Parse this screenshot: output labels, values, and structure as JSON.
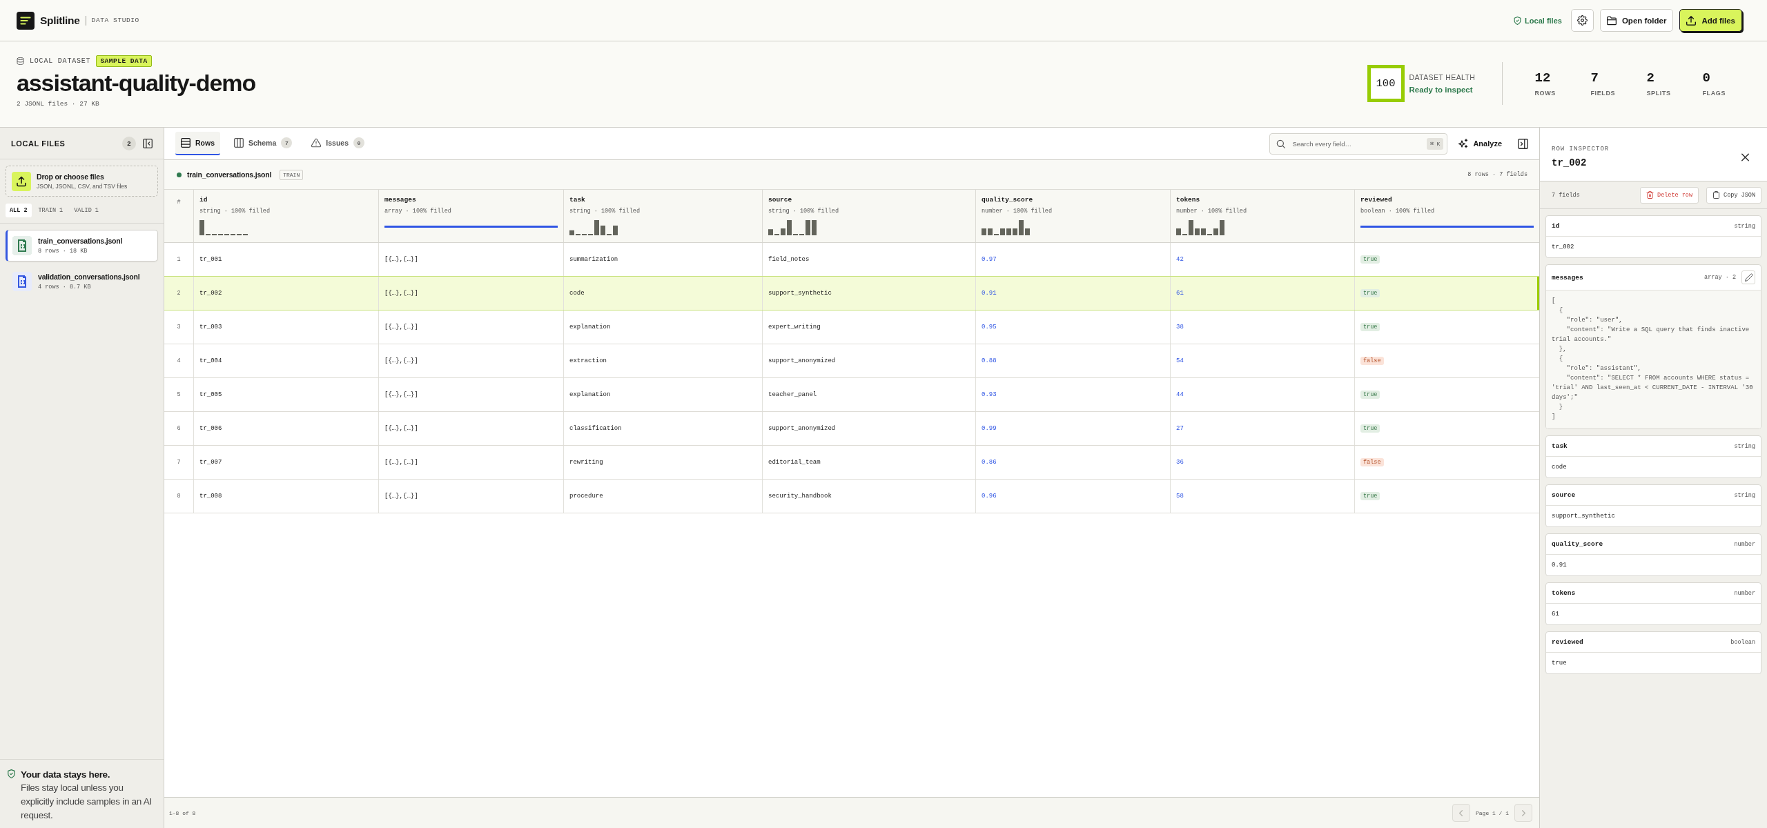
{
  "app": {
    "name": "Splitline",
    "product": "DATA STUDIO"
  },
  "topbar": {
    "status": "Local files",
    "buttons": [
      {
        "kind": "settings"
      },
      {
        "kind": "open",
        "label": "Open folder"
      },
      {
        "kind": "add",
        "label": "Add files"
      }
    ]
  },
  "dataset": {
    "eyebrow": "LOCAL DATASET",
    "badge": "SAMPLE DATA",
    "title": "assistant-quality-demo",
    "meta": "2 JSONL files · 27 KB"
  },
  "health": {
    "score": "100",
    "label": "DATASET HEALTH",
    "status": "Ready to inspect"
  },
  "stats": [
    {
      "value": "12",
      "label": "ROWS"
    },
    {
      "value": "7",
      "label": "FIELDS"
    },
    {
      "value": "2",
      "label": "SPLITS"
    },
    {
      "value": "0",
      "label": "FLAGS"
    }
  ],
  "sidebar": {
    "title": "LOCAL FILES",
    "count": "2",
    "dropzone": {
      "title": "Drop or choose files",
      "hint": "JSON, JSONL, CSV, and TSV files"
    },
    "filters": [
      {
        "label": "ALL 2",
        "selected": true
      },
      {
        "label": "TRAIN 1",
        "selected": false
      },
      {
        "label": "VALID 1",
        "selected": false
      }
    ],
    "files": [
      {
        "name": "train_conversations.jsonl",
        "meta": "8 rows · 18 KB",
        "color": "#2f7a4f",
        "selected": true
      },
      {
        "name": "validation_conversations.jsonl",
        "meta": "4 rows · 8.7 KB",
        "color": "#3457e0",
        "selected": false
      }
    ],
    "notice": {
      "title": "Your data stays here.",
      "text": "Files stay local unless you explicitly include samples in an AI request."
    }
  },
  "tabs": [
    {
      "kind": "rows",
      "label": "Rows",
      "selected": true
    },
    {
      "kind": "schema",
      "label": "Schema",
      "count": "7",
      "selected": false
    },
    {
      "kind": "issues",
      "label": "Issues",
      "count": "0",
      "selected": false
    }
  ],
  "search": {
    "placeholder": "Search every field…",
    "shortcut": "⌘ K"
  },
  "analyze_button": {
    "label": "Analyze"
  },
  "file_bar": {
    "name": "train_conversations.jsonl",
    "split": "TRAIN",
    "summary": "8 rows · 7 fields"
  },
  "table": {
    "index_header": "#",
    "columns": [
      {
        "name": "id",
        "type": "string · 100% filled",
        "kind": "string"
      },
      {
        "name": "messages",
        "type": "array · 100% filled",
        "kind": "array"
      },
      {
        "name": "task",
        "type": "string · 100% filled",
        "kind": "string"
      },
      {
        "name": "source",
        "type": "string · 100% filled",
        "kind": "string"
      },
      {
        "name": "quality_score",
        "type": "number · 100% filled",
        "kind": "number"
      },
      {
        "name": "tokens",
        "type": "number · 100% filled",
        "kind": "number"
      },
      {
        "name": "reviewed",
        "type": "boolean · 100% filled",
        "kind": "boolean"
      }
    ],
    "rows": [
      {
        "index": "1",
        "selected": false,
        "cells": [
          "tr_001",
          "[{…},{…}]",
          "summarization",
          "field_notes",
          "0.97",
          "42",
          {
            "text": "true",
            "on": true
          }
        ]
      },
      {
        "index": "2",
        "selected": true,
        "cells": [
          "tr_002",
          "[{…},{…}]",
          "code",
          "support_synthetic",
          "0.91",
          "61",
          {
            "text": "true",
            "on": true
          }
        ]
      },
      {
        "index": "3",
        "selected": false,
        "cells": [
          "tr_003",
          "[{…},{…}]",
          "explanation",
          "expert_writing",
          "0.95",
          "38",
          {
            "text": "true",
            "on": true
          }
        ]
      },
      {
        "index": "4",
        "selected": false,
        "cells": [
          "tr_004",
          "[{…},{…}]",
          "extraction",
          "support_anonymized",
          "0.88",
          "54",
          {
            "text": "false",
            "on": false
          }
        ]
      },
      {
        "index": "5",
        "selected": false,
        "cells": [
          "tr_005",
          "[{…},{…}]",
          "explanation",
          "teacher_panel",
          "0.93",
          "44",
          {
            "text": "true",
            "on": true
          }
        ]
      },
      {
        "index": "6",
        "selected": false,
        "cells": [
          "tr_006",
          "[{…},{…}]",
          "classification",
          "support_anonymized",
          "0.99",
          "27",
          {
            "text": "true",
            "on": true
          }
        ]
      },
      {
        "index": "7",
        "selected": false,
        "cells": [
          "tr_007",
          "[{…},{…}]",
          "rewriting",
          "editorial_team",
          "0.86",
          "36",
          {
            "text": "false",
            "on": false
          }
        ]
      },
      {
        "index": "8",
        "selected": false,
        "cells": [
          "tr_008",
          "[{…},{…}]",
          "procedure",
          "security_handbook",
          "0.96",
          "58",
          {
            "text": "true",
            "on": true
          }
        ]
      }
    ]
  },
  "pagination": {
    "range": "1–8 of 8",
    "page": "Page 1 / 1",
    "prev_disabled": true,
    "next_disabled": true
  },
  "inspector": {
    "eyebrow": "ROW INSPECTOR",
    "title": "tr_002",
    "field_count": "7 fields",
    "actions": [
      {
        "kind": "delete",
        "label": "Delete row"
      },
      {
        "kind": "copy",
        "label": "Copy JSON"
      }
    ],
    "fields": [
      {
        "name": "id",
        "type": "string",
        "kind": "text",
        "editable": false,
        "value": "tr_002"
      },
      {
        "name": "messages",
        "type": "array · 2",
        "kind": "code",
        "editable": true,
        "value": "[\n  {\n    \"role\": \"user\",\n    \"content\": \"Write a SQL query that finds inactive trial accounts.\"\n  },\n  {\n    \"role\": \"assistant\",\n    \"content\": \"SELECT * FROM accounts WHERE status = 'trial' AND last_seen_at < CURRENT_DATE - INTERVAL '30 days';\"\n  }\n]"
      },
      {
        "name": "task",
        "type": "string",
        "kind": "text",
        "editable": false,
        "value": "code"
      },
      {
        "name": "source",
        "type": "string",
        "kind": "text",
        "editable": false,
        "value": "support_synthetic"
      },
      {
        "name": "quality_score",
        "type": "number",
        "kind": "text",
        "editable": false,
        "value": "0.91"
      },
      {
        "name": "tokens",
        "type": "number",
        "kind": "text",
        "editable": false,
        "value": "61"
      },
      {
        "name": "reviewed",
        "type": "boolean",
        "kind": "text",
        "editable": false,
        "value": "true"
      }
    ]
  }
}
